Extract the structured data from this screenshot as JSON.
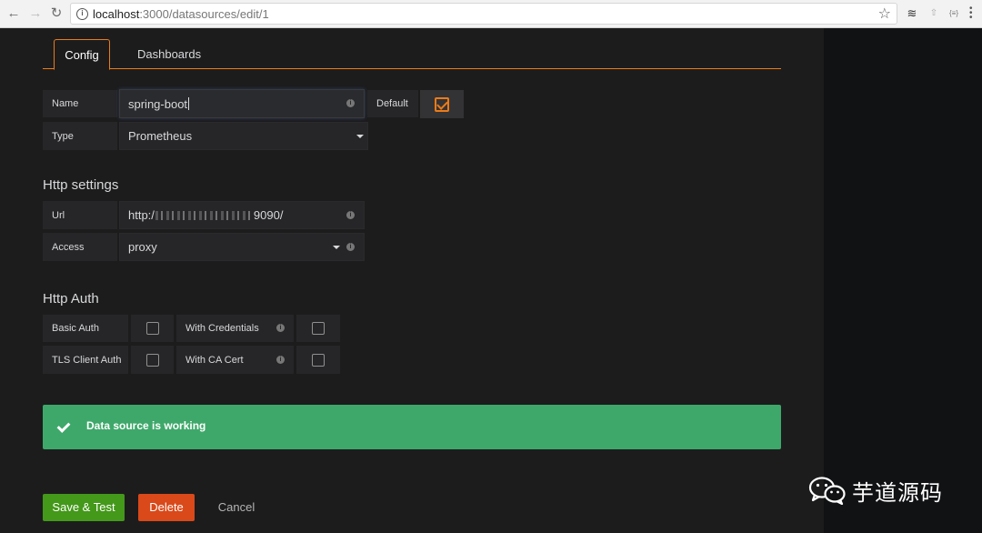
{
  "browser": {
    "url_host": "localhost",
    "url_path": ":3000/datasources/edit/1"
  },
  "tabs": [
    {
      "label": "Config",
      "active": true
    },
    {
      "label": "Dashboards",
      "active": false
    }
  ],
  "general": {
    "name_label": "Name",
    "name_value": "spring-boot",
    "default_label": "Default",
    "default_checked": true,
    "type_label": "Type",
    "type_value": "Prometheus"
  },
  "http_settings": {
    "title": "Http settings",
    "url_label": "Url",
    "url_prefix": "http:/",
    "url_suffix": "9090/",
    "access_label": "Access",
    "access_value": "proxy"
  },
  "http_auth": {
    "title": "Http Auth",
    "basic_auth_label": "Basic Auth",
    "basic_auth_checked": false,
    "with_credentials_label": "With Credentials",
    "with_credentials_checked": false,
    "tls_client_auth_label": "TLS Client Auth",
    "tls_client_auth_checked": false,
    "with_ca_cert_label": "With CA Cert",
    "with_ca_cert_checked": false
  },
  "status": {
    "message": "Data source is working",
    "color": "#3ea86a"
  },
  "actions": {
    "save_label": "Save & Test",
    "delete_label": "Delete",
    "cancel_label": "Cancel"
  },
  "watermark": {
    "text": "芋道源码"
  },
  "colors": {
    "accent": "#eb7b18",
    "save": "#44981a",
    "delete": "#d9491a",
    "background": "#1c1c1d"
  }
}
